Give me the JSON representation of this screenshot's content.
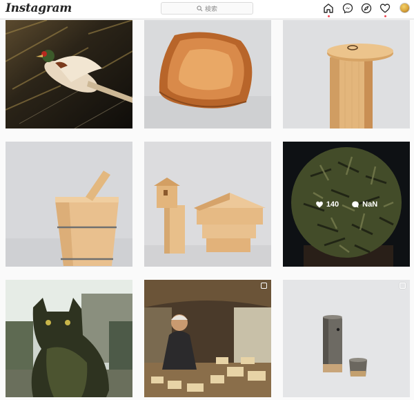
{
  "header": {
    "logo_text": "Instagram",
    "search": {
      "placeholder": "検索"
    },
    "nav": [
      {
        "name": "home-icon",
        "active": true
      },
      {
        "name": "messenger-icon"
      },
      {
        "name": "explore-icon"
      },
      {
        "name": "activity-heart-icon",
        "notification": true
      },
      {
        "name": "profile-avatar"
      }
    ]
  },
  "posts": [
    {
      "subject": "pheasant",
      "row": 1,
      "col": 1
    },
    {
      "subject": "wooden-bowl",
      "row": 1,
      "col": 2
    },
    {
      "subject": "wooden-canister",
      "row": 1,
      "col": 3
    },
    {
      "subject": "wooden-bucket",
      "row": 2,
      "col": 1
    },
    {
      "subject": "wooden-house-boxes",
      "row": 2,
      "col": 2
    },
    {
      "subject": "wood-sphere-sculpture",
      "row": 2,
      "col": 3,
      "hover": true,
      "likes": "140",
      "comments": "NaN"
    },
    {
      "subject": "cat-in-workshop",
      "row": 3,
      "col": 1
    },
    {
      "subject": "craftsman-workshop",
      "row": 3,
      "col": 2,
      "multi": true
    },
    {
      "subject": "canister-and-cup",
      "row": 3,
      "col": 3,
      "multi": true
    }
  ],
  "colors": {
    "accent_dot": "#ed4956",
    "border": "#dbdbdb",
    "background": "#fafafa"
  }
}
